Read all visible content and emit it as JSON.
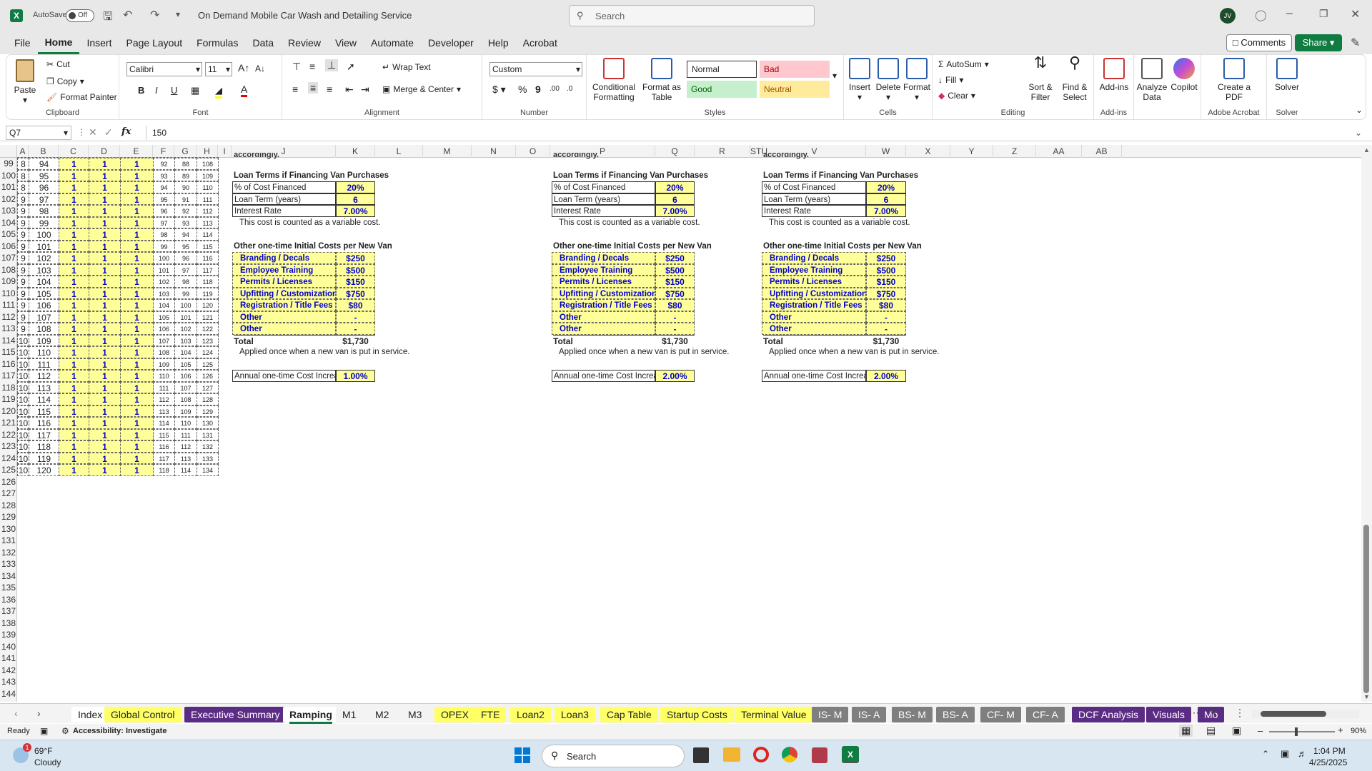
{
  "titlebar": {
    "autosave_label": "AutoSave",
    "autosave_state": "Off",
    "doc_title": "On Demand Mobile Car Wash and Detailing Service",
    "search_placeholder": "Search",
    "avatar_initials": "JV"
  },
  "menu": {
    "tabs": [
      "File",
      "Home",
      "Insert",
      "Page Layout",
      "Formulas",
      "Data",
      "Review",
      "View",
      "Automate",
      "Developer",
      "Help",
      "Acrobat"
    ],
    "active": "Home",
    "comments": "Comments",
    "share": "Share"
  },
  "ribbon": {
    "clipboard": {
      "paste": "Paste",
      "cut": "Cut",
      "copy": "Copy",
      "format_painter": "Format Painter",
      "label": "Clipboard"
    },
    "font": {
      "name": "Calibri",
      "size": "11",
      "label": "Font"
    },
    "alignment": {
      "wrap": "Wrap Text",
      "merge": "Merge & Center",
      "label": "Alignment"
    },
    "number": {
      "format": "Custom",
      "label": "Number"
    },
    "styles": {
      "cond": "Conditional Formatting",
      "table": "Format as Table",
      "normal": "Normal",
      "bad": "Bad",
      "good": "Good",
      "neutral": "Neutral",
      "label": "Styles"
    },
    "cells": {
      "insert": "Insert",
      "delete": "Delete",
      "format": "Format",
      "label": "Cells"
    },
    "editing": {
      "autosum": "AutoSum",
      "fill": "Fill",
      "clear": "Clear",
      "sort": "Sort & Filter",
      "find": "Find & Select",
      "label": "Editing"
    },
    "addins": {
      "addins": "Add-ins",
      "label": "Add-ins"
    },
    "analyze": {
      "analyze": "Analyze Data",
      "copilot": "Copilot"
    },
    "acrobat": {
      "create": "Create a PDF",
      "label": "Adobe Acrobat"
    },
    "solver": {
      "solver": "Solver",
      "label": "Solver"
    }
  },
  "formula": {
    "namebox": "Q7",
    "value": "150"
  },
  "columns": [
    "A",
    "B",
    "C",
    "D",
    "E",
    "F",
    "G",
    "H",
    "I",
    "J",
    "K",
    "L",
    "M",
    "N",
    "O",
    "P",
    "Q",
    "R",
    "STU",
    "V",
    "W",
    "X",
    "Y",
    "Z",
    "AA",
    "AB"
  ],
  "rows": {
    "numbers": [
      99,
      100,
      101,
      102,
      103,
      104,
      105,
      106,
      107,
      108,
      109,
      110,
      111,
      112,
      113,
      114,
      115,
      116,
      117,
      118,
      119,
      120,
      121,
      122,
      123,
      124,
      125,
      126,
      127,
      128,
      129,
      130,
      131,
      132,
      133,
      134,
      135,
      136,
      137,
      138,
      139,
      140,
      141,
      142,
      143,
      144
    ],
    "data": [
      [
        "8",
        "94",
        "1",
        "1",
        "1",
        "92",
        "88",
        "108"
      ],
      [
        "8",
        "95",
        "1",
        "1",
        "1",
        "93",
        "89",
        "109"
      ],
      [
        "8",
        "96",
        "1",
        "1",
        "1",
        "94",
        "90",
        "110"
      ],
      [
        "9",
        "97",
        "1",
        "1",
        "1",
        "95",
        "91",
        "111"
      ],
      [
        "9",
        "98",
        "1",
        "1",
        "1",
        "96",
        "92",
        "112"
      ],
      [
        "9",
        "99",
        "1",
        "1",
        "1",
        "97",
        "93",
        "113"
      ],
      [
        "9",
        "100",
        "1",
        "1",
        "1",
        "98",
        "94",
        "114"
      ],
      [
        "9",
        "101",
        "1",
        "1",
        "1",
        "99",
        "95",
        "115"
      ],
      [
        "9",
        "102",
        "1",
        "1",
        "1",
        "100",
        "96",
        "116"
      ],
      [
        "9",
        "103",
        "1",
        "1",
        "1",
        "101",
        "97",
        "117"
      ],
      [
        "9",
        "104",
        "1",
        "1",
        "1",
        "102",
        "98",
        "118"
      ],
      [
        "9",
        "105",
        "1",
        "1",
        "1",
        "103",
        "99",
        "119"
      ],
      [
        "9",
        "106",
        "1",
        "1",
        "1",
        "104",
        "100",
        "120"
      ],
      [
        "9",
        "107",
        "1",
        "1",
        "1",
        "105",
        "101",
        "121"
      ],
      [
        "9",
        "108",
        "1",
        "1",
        "1",
        "106",
        "102",
        "122"
      ],
      [
        "10",
        "109",
        "1",
        "1",
        "1",
        "107",
        "103",
        "123"
      ],
      [
        "10",
        "110",
        "1",
        "1",
        "1",
        "108",
        "104",
        "124"
      ],
      [
        "10",
        "111",
        "1",
        "1",
        "1",
        "109",
        "105",
        "125"
      ],
      [
        "10",
        "112",
        "1",
        "1",
        "1",
        "110",
        "106",
        "126"
      ],
      [
        "10",
        "113",
        "1",
        "1",
        "1",
        "111",
        "107",
        "127"
      ],
      [
        "10",
        "114",
        "1",
        "1",
        "1",
        "112",
        "108",
        "128"
      ],
      [
        "10",
        "115",
        "1",
        "1",
        "1",
        "113",
        "109",
        "129"
      ],
      [
        "10",
        "116",
        "1",
        "1",
        "1",
        "114",
        "110",
        "130"
      ],
      [
        "10",
        "117",
        "1",
        "1",
        "1",
        "115",
        "111",
        "131"
      ],
      [
        "10",
        "118",
        "1",
        "1",
        "1",
        "116",
        "112",
        "132"
      ],
      [
        "10",
        "119",
        "1",
        "1",
        "1",
        "117",
        "113",
        "133"
      ],
      [
        "10",
        "120",
        "1",
        "1",
        "1",
        "118",
        "114",
        "134"
      ]
    ]
  },
  "scenarios": [
    {
      "top_cut": "accordingly.",
      "loan_title": "Loan Terms if Financing Van Purchases",
      "loan_rows": [
        [
          "% of Cost Financed",
          "20%"
        ],
        [
          "Loan Term (years)",
          "6"
        ],
        [
          "Interest Rate",
          "7.00%"
        ]
      ],
      "loan_note": "This cost is counted as a variable cost.",
      "other_title": "Other one-time Initial Costs per New Van",
      "other_rows": [
        [
          "Branding / Decals",
          "$250"
        ],
        [
          "Employee Training",
          "$500"
        ],
        [
          "Permits / Licenses",
          "$150"
        ],
        [
          "Upfitting / Customizations",
          "$750"
        ],
        [
          "Registration / Title Fees",
          "$80"
        ],
        [
          "Other",
          "-"
        ],
        [
          "Other",
          "-"
        ]
      ],
      "total_label": "Total",
      "total_value": "$1,730",
      "other_note": "Applied once when a new van is put in service.",
      "annual_label": "Annual one-time Cost Increases",
      "annual_value": "1.00%"
    },
    {
      "top_cut": "accordingly.",
      "loan_title": "Loan Terms if Financing Van Purchases",
      "loan_rows": [
        [
          "% of Cost Financed",
          "20%"
        ],
        [
          "Loan Term (years)",
          "6"
        ],
        [
          "Interest Rate",
          "7.00%"
        ]
      ],
      "loan_note": "This cost is counted as a variable cost.",
      "other_title": "Other one-time Initial Costs per New Van",
      "other_rows": [
        [
          "Branding / Decals",
          "$250"
        ],
        [
          "Employee Training",
          "$500"
        ],
        [
          "Permits / Licenses",
          "$150"
        ],
        [
          "Upfitting / Customizations",
          "$750"
        ],
        [
          "Registration / Title Fees",
          "$80"
        ],
        [
          "Other",
          "-"
        ],
        [
          "Other",
          "-"
        ]
      ],
      "total_label": "Total",
      "total_value": "$1,730",
      "other_note": "Applied once when a new van is put in service.",
      "annual_label": "Annual one-time Cost Increases",
      "annual_value": "2.00%"
    },
    {
      "top_cut": "accordingly.",
      "loan_title": "Loan Terms if Financing Van Purchases",
      "loan_rows": [
        [
          "% of Cost Financed",
          "20%"
        ],
        [
          "Loan Term (years)",
          "6"
        ],
        [
          "Interest Rate",
          "7.00%"
        ]
      ],
      "loan_note": "This cost is counted as a variable cost.",
      "other_title": "Other one-time Initial Costs per New Van",
      "other_rows": [
        [
          "Branding / Decals",
          "$250"
        ],
        [
          "Employee Training",
          "$500"
        ],
        [
          "Permits / Licenses",
          "$150"
        ],
        [
          "Upfitting / Customizations",
          "$750"
        ],
        [
          "Registration / Title Fees",
          "$80"
        ],
        [
          "Other",
          "-"
        ],
        [
          "Other",
          "-"
        ]
      ],
      "total_label": "Total",
      "total_value": "$1,730",
      "other_note": "Applied once when a new van is put in service.",
      "annual_label": "Annual one-time Cost Increases",
      "annual_value": "2.00%"
    }
  ],
  "sheet_tabs": [
    {
      "label": "Index",
      "bg": "#ffffff",
      "fg": "#222222"
    },
    {
      "label": "Global Control",
      "bg": "#ffff66",
      "fg": "#222222"
    },
    {
      "label": "Executive Summary",
      "bg": "#5b2c83",
      "fg": "#ffffff"
    },
    {
      "label": "Ramping",
      "bg": "#ffffff",
      "fg": "#222222",
      "active": true
    },
    {
      "label": "M1",
      "bg": "#f3f3f3",
      "fg": "#222222"
    },
    {
      "label": "M2",
      "bg": "#f3f3f3",
      "fg": "#222222"
    },
    {
      "label": "M3",
      "bg": "#f3f3f3",
      "fg": "#222222"
    },
    {
      "label": "OPEX",
      "bg": "#ffff66",
      "fg": "#222222"
    },
    {
      "label": "FTE",
      "bg": "#ffff66",
      "fg": "#222222"
    },
    {
      "label": "Loan2",
      "bg": "#ffff66",
      "fg": "#222222"
    },
    {
      "label": "Loan3",
      "bg": "#ffff66",
      "fg": "#222222"
    },
    {
      "label": "Cap Table",
      "bg": "#ffff66",
      "fg": "#222222"
    },
    {
      "label": "Startup Costs",
      "bg": "#ffff66",
      "fg": "#222222"
    },
    {
      "label": "Terminal Value",
      "bg": "#ffff66",
      "fg": "#222222"
    },
    {
      "label": "IS- M",
      "bg": "#7f7f7f",
      "fg": "#ffffff"
    },
    {
      "label": "IS- A",
      "bg": "#7f7f7f",
      "fg": "#ffffff"
    },
    {
      "label": "BS- M",
      "bg": "#7f7f7f",
      "fg": "#ffffff"
    },
    {
      "label": "BS- A",
      "bg": "#7f7f7f",
      "fg": "#ffffff"
    },
    {
      "label": "CF- M",
      "bg": "#7f7f7f",
      "fg": "#ffffff"
    },
    {
      "label": "CF- A",
      "bg": "#7f7f7f",
      "fg": "#ffffff"
    },
    {
      "label": "DCF Analysis",
      "bg": "#5b2c83",
      "fg": "#ffffff"
    },
    {
      "label": "Visuals",
      "bg": "#5b2c83",
      "fg": "#ffffff"
    },
    {
      "label": "Mo",
      "bg": "#5b2c83",
      "fg": "#ffffff"
    }
  ],
  "status": {
    "ready": "Ready",
    "accessibility": "Accessibility: Investigate",
    "zoom": "90%"
  },
  "taskbar": {
    "temp": "69°F",
    "weather": "Cloudy",
    "search": "Search",
    "time": "1:04 PM",
    "date": "4/25/2025",
    "badge": "1"
  }
}
